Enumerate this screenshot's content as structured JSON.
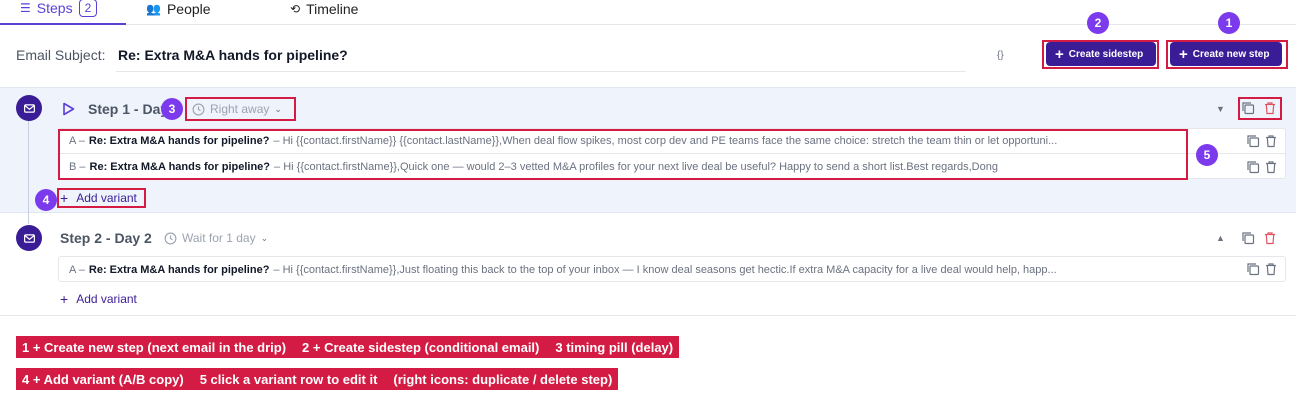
{
  "tabs": [
    {
      "label": "Steps",
      "badge": "2",
      "active": true
    },
    {
      "label": "People"
    },
    {
      "label": "Timeline"
    }
  ],
  "subject": {
    "label": "Email Subject:",
    "value": "Re: Extra M&A hands for pipeline?",
    "braces": "{}"
  },
  "buttons": {
    "create_sidestep": "Create sidestep",
    "create_new_step": "Create new step"
  },
  "steps": [
    {
      "title": "Step 1 - Day 1",
      "timing": "Right away",
      "variants": [
        {
          "letter": "A –",
          "subject": "Re: Extra M&A hands for pipeline?",
          "body": "– Hi {{contact.firstName}} {{contact.lastName}},When deal flow spikes, most corp dev and PE teams face the same choice: stretch the team thin or let opportuni..."
        },
        {
          "letter": "B –",
          "subject": "Re: Extra M&A hands for pipeline?",
          "body": "– Hi {{contact.firstName}},Quick one — would 2–3 vetted M&A profiles for your next live deal be useful? Happy to send a short list.Best regards,Dong"
        }
      ],
      "add_variant": "Add variant"
    },
    {
      "title": "Step 2 - Day 2",
      "timing": "Wait for 1 day",
      "variants": [
        {
          "letter": "A –",
          "subject": "Re: Extra M&A hands for pipeline?",
          "body": "– Hi {{contact.firstName}},Just floating this back to the top of your inbox — I know deal seasons get hectic.If extra M&A capacity for a live deal would help, happ..."
        }
      ],
      "add_variant": "Add variant"
    }
  ],
  "annotations": {
    "markers": [
      "1",
      "2",
      "3",
      "4",
      "5"
    ],
    "legend_line1": [
      "1 + Create new step (next email in the drip)",
      "2 + Create sidestep (conditional email)",
      "3 timing pill (delay)"
    ],
    "legend_line2": [
      "4 + Add variant (A/B copy)",
      "5 click a variant row to edit it",
      "(right icons: duplicate / delete step)"
    ]
  },
  "colors": {
    "brand": "#3a1d96",
    "accent": "#5b3fd6",
    "annotation": "#d41b43",
    "marker": "#7c3aed",
    "step_highlight_bg": "#eef3fc"
  }
}
